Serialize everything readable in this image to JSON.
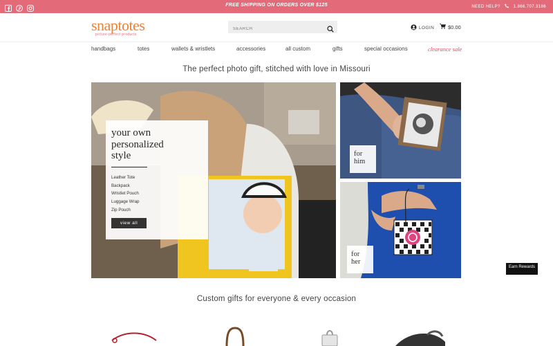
{
  "topbar": {
    "promo": "FREE SHIPPING ON ORDERS OVER $125",
    "help": "NEED HELP?",
    "phone": "1.866.707.3186",
    "social": [
      "facebook-icon",
      "pinterest-icon",
      "instagram-icon"
    ]
  },
  "header": {
    "logo_text": "snaptotes",
    "logo_tag": "picture-perfect products",
    "search_placeholder": "SEARCH",
    "login": "LOGIN",
    "cart": "$0.00"
  },
  "nav": {
    "items": [
      "handbags",
      "totes",
      "wallets & wristlets",
      "accessories",
      "all custom",
      "gifts",
      "special occasions"
    ],
    "clearance": "clearance sale"
  },
  "tagline": "The perfect photo gift, stitched with love in Missouri",
  "hero": {
    "title_lines": [
      "your own",
      "personalized",
      "style"
    ],
    "links": [
      "Leather Tote",
      "Backpack",
      "Wristlet Pouch",
      "Luggage Wrap",
      "Zip Pouch"
    ],
    "button": "view all",
    "him_lines": [
      "for",
      "him"
    ],
    "her_lines": [
      "for",
      "her"
    ]
  },
  "section2_title": "Custom gifts for everyone & every occasion",
  "rewards": "Earn Rewards",
  "colors": {
    "topbar": "#e36b79",
    "logo": "#e8833a",
    "clearance": "#e0475a"
  }
}
